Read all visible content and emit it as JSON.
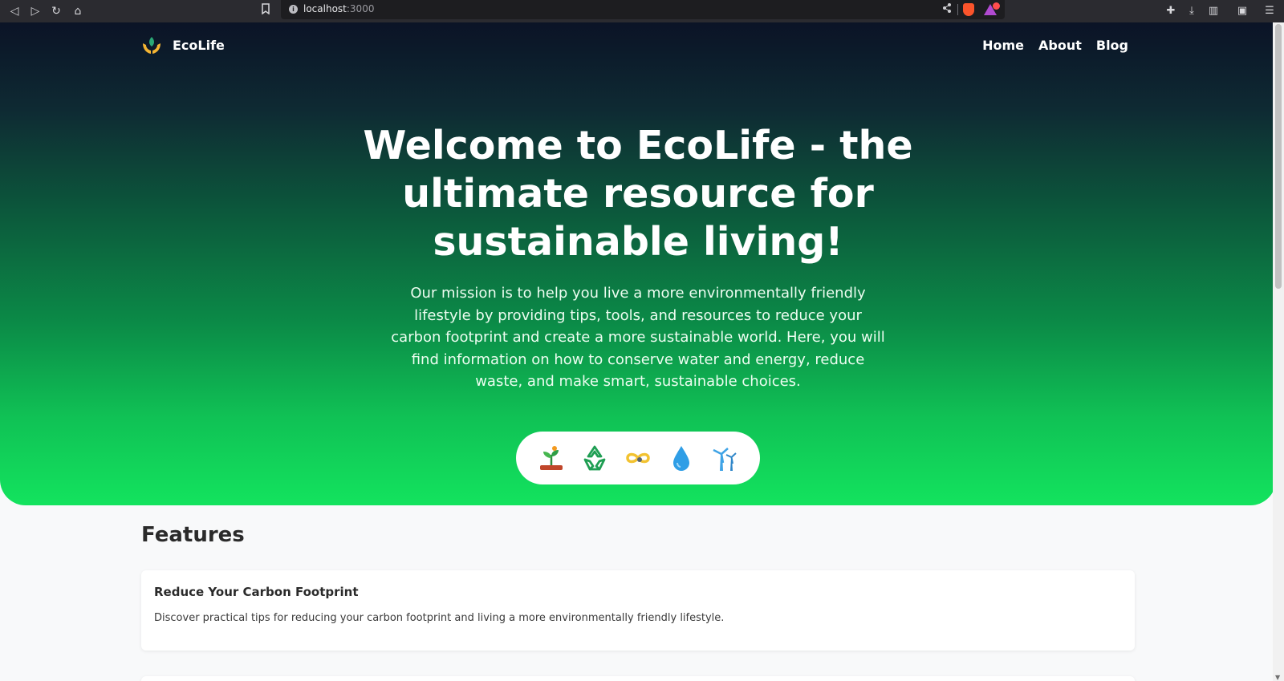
{
  "browser": {
    "url_host": "localhost",
    "url_port": ":3000"
  },
  "nav": {
    "brand": "EcoLife",
    "links": [
      "Home",
      "About",
      "Blog"
    ]
  },
  "hero": {
    "title": "Welcome to EcoLife - the ultimate resource for sustainable living!",
    "text": "Our mission is to help you live a more environmentally friendly lifestyle by providing tips, tools, and resources to reduce your carbon footprint and create a more sustainable world. Here, you will find information on how to conserve water and energy, reduce waste, and make smart, sustainable choices.",
    "icons": [
      "seedling-icon",
      "recycle-icon",
      "infinity-icon",
      "water-drop-icon",
      "wind-turbine-icon"
    ]
  },
  "features": {
    "title": "Features",
    "cards": [
      {
        "title": "Reduce Your Carbon Footprint",
        "text": "Discover practical tips for reducing your carbon footprint and living a more environmentally friendly lifestyle."
      }
    ]
  },
  "colors": {
    "hero_top": "#0b1326",
    "hero_bottom": "#13e35e",
    "page_bg": "#f8f9fa"
  }
}
